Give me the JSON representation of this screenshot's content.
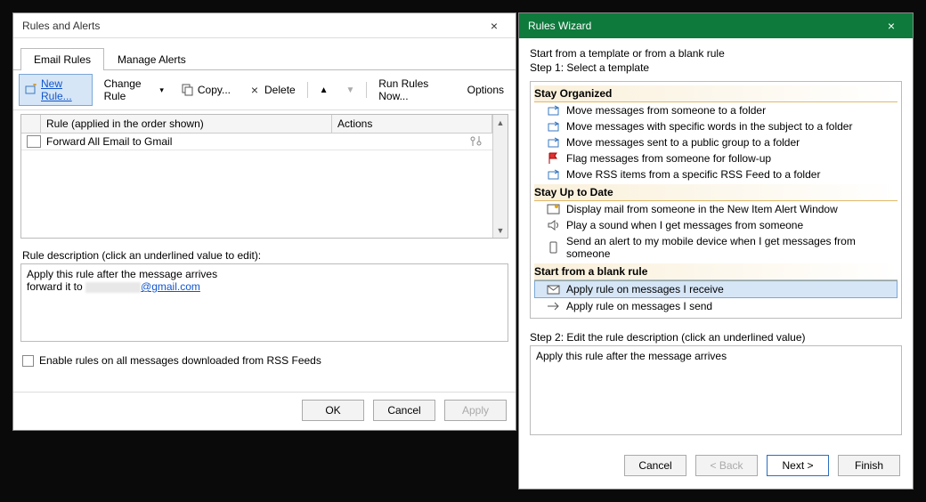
{
  "rules_window": {
    "title": "Rules and Alerts",
    "tabs": {
      "email": "Email Rules",
      "alerts": "Manage Alerts"
    },
    "toolbar": {
      "new_rule": "New Rule...",
      "change_rule": "Change Rule",
      "copy": "Copy...",
      "delete": "Delete",
      "run_now": "Run Rules Now...",
      "options": "Options"
    },
    "list": {
      "hdr_rule": "Rule (applied in the order shown)",
      "hdr_actions": "Actions",
      "rows": [
        {
          "name": "Forward All Email to Gmail"
        }
      ]
    },
    "desc_label": "Rule description (click an underlined value to edit):",
    "desc_line1": "Apply this rule after the message arrives",
    "desc_forward_prefix": "forward it to ",
    "desc_email_suffix": "@gmail.com",
    "rss_label": "Enable rules on all messages downloaded from RSS Feeds",
    "buttons": {
      "ok": "OK",
      "cancel": "Cancel",
      "apply": "Apply"
    }
  },
  "wizard": {
    "title": "Rules Wizard",
    "line1": "Start from a template or from a blank rule",
    "line2": "Step 1: Select a template",
    "sections": {
      "organized": "Stay Organized",
      "uptodate": "Stay Up to Date",
      "blank": "Start from a blank rule"
    },
    "organized_items": [
      "Move messages from someone to a folder",
      "Move messages with specific words in the subject to a folder",
      "Move messages sent to a public group to a folder",
      "Flag messages from someone for follow-up",
      "Move RSS items from a specific RSS Feed to a folder"
    ],
    "uptodate_items": [
      "Display mail from someone in the New Item Alert Window",
      "Play a sound when I get messages from someone",
      "Send an alert to my mobile device when I get messages from someone"
    ],
    "blank_items": [
      "Apply rule on messages I receive",
      "Apply rule on messages I send"
    ],
    "step2_label": "Step 2: Edit the rule description (click an underlined value)",
    "step2_desc": "Apply this rule after the message arrives",
    "buttons": {
      "cancel": "Cancel",
      "back": "< Back",
      "next": "Next >",
      "finish": "Finish"
    }
  }
}
